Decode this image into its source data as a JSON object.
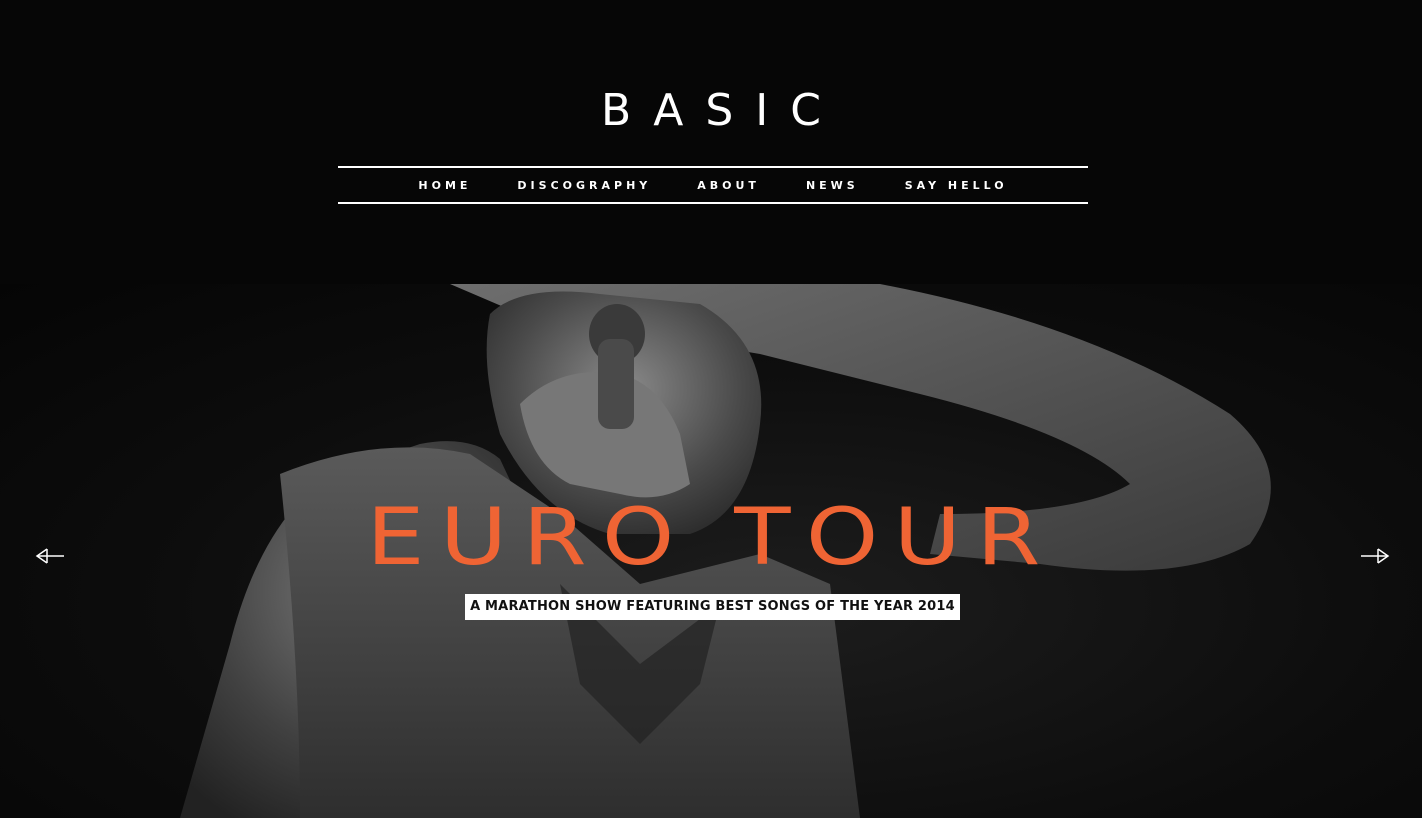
{
  "site": {
    "logo": "BASIC"
  },
  "nav": {
    "items": [
      {
        "label": "HOME"
      },
      {
        "label": "DISCOGRAPHY"
      },
      {
        "label": "ABOUT"
      },
      {
        "label": "NEWS"
      },
      {
        "label": "SAY HELLO"
      }
    ]
  },
  "hero": {
    "title": "EURO TOUR",
    "subtitle": "A MARATHON SHOW FEATURING BEST SONGS OF THE YEAR 2014",
    "prev_icon": "arrow-left-icon",
    "next_icon": "arrow-right-icon"
  },
  "colors": {
    "background": "#060606",
    "accent": "#ef6434",
    "text": "#ffffff"
  }
}
